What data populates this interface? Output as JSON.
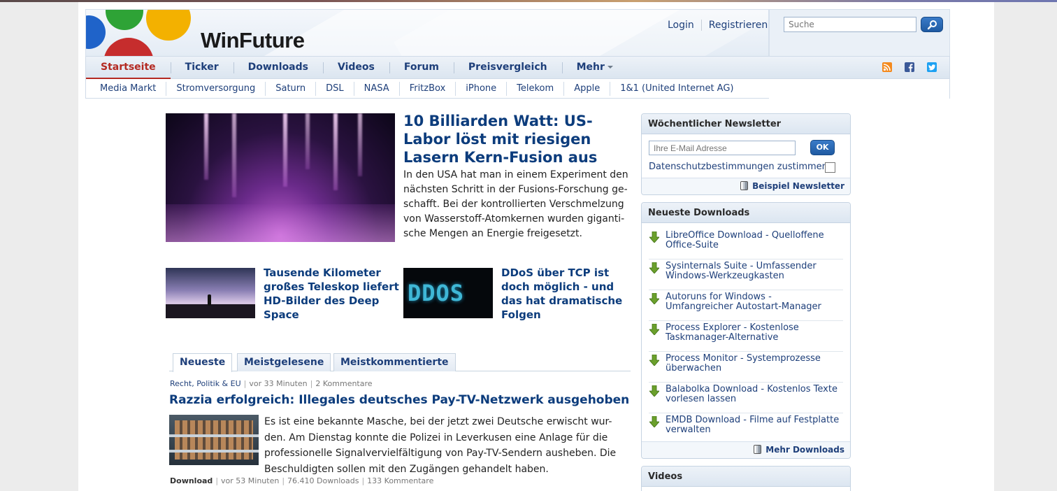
{
  "brand": {
    "logo_text": "WinFuture"
  },
  "header": {
    "auth": {
      "login": "Login",
      "register": "Registrieren"
    },
    "search": {
      "placeholder": "Suche"
    }
  },
  "mainnav": {
    "items": [
      "Startseite",
      "Ticker",
      "Downloads",
      "Videos",
      "Forum",
      "Preisvergleich",
      "Mehr"
    ],
    "active": "Startseite"
  },
  "subnav": {
    "items": [
      "Media Markt",
      "Stromversorgung",
      "Saturn",
      "DSL",
      "NASA",
      "FritzBox",
      "iPhone",
      "Telekom",
      "Apple",
      "1&1 (United Internet AG)"
    ]
  },
  "hero": {
    "title": "10 Billiarden Watt: US-Labor löst mit riesigen Lasern Kern-Fusion aus",
    "text": "In den USA hat man in einem Experiment den nächsten Schritt in der Fusions-Forschung ge-schafft. Bei der kontrollierten Verschmelzung von Wasserstoff-Atomkernen wurden giganti-sche Mengen an Energie freigesetzt."
  },
  "teasers": [
    {
      "title": "Tausende Kilometer großes Teleskop liefert HD-Bilder des Deep Space"
    },
    {
      "title": "DDoS über TCP ist doch möglich - und das hat dramatische Folgen",
      "image_text": "DDOS"
    }
  ],
  "tabs": [
    "Neueste",
    "Meistgelesene",
    "Meistkommentierte"
  ],
  "articles": [
    {
      "category": "Recht, Politik & EU",
      "time": "vor 33 Minuten",
      "comments": "2 Kommentare",
      "title": "Razzia erfolgreich: Illegales deutsches Pay-TV-Netzwerk ausgehoben",
      "text": "Es ist eine bekannte Masche, bei der jetzt zwei Deutsche erwischt wur-den. Am Dienstag konnte die Polizei in Leverkusen eine Anlage für die professionelle Signalvervielfältigung von Pay-TV-Sendern ausheben. Die Beschuldigten sollen mit den Zugängen gehandelt haben."
    },
    {
      "category": "Download",
      "time": "vor 53 Minuten",
      "downloads": "76.410 Downloads",
      "comments": "133 Kommentare"
    }
  ],
  "newsletter": {
    "title": "Wöchentlicher Newsletter",
    "email_placeholder": "Ihre E-Mail Adresse",
    "ok": "OK",
    "consent": "Datenschutzbestimmungen zustimmen",
    "example": "Beispiel Newsletter"
  },
  "downloads_box": {
    "title": "Neueste Downloads",
    "items": [
      "LibreOffice Download - Quelloffene Office-Suite",
      "Sysinternals Suite - Umfassender Windows-Werkzeugkasten",
      "Autoruns for Windows - Umfangreicher Autostart-Manager",
      "Process Explorer - Kostenlose Taskmanager-Alternative",
      "Process Monitor - Systemprozesse überwachen",
      "Balabolka Download - Kostenlos Texte vorlesen lassen",
      "EMDB Download - Filme auf Festplatte verwalten"
    ],
    "more": "Mehr Downloads"
  },
  "videos_box": {
    "title": "Videos"
  },
  "colors": {
    "accent": "#b42a22",
    "link": "#0c3c7c",
    "button": "#1f5aa2"
  }
}
